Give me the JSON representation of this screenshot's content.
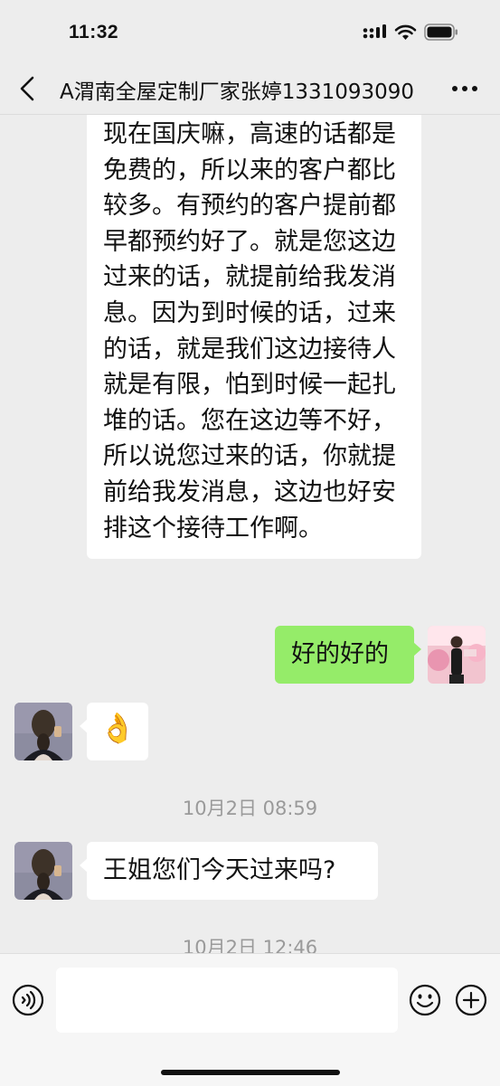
{
  "status_bar": {
    "time": "11:32"
  },
  "header": {
    "title": "A渭南全屋定制厂家张婷1331093090",
    "back_icon": "chevron-left-icon",
    "more_icon": "more-dots-icon"
  },
  "messages": [
    {
      "side": "in",
      "text": "现在国庆嘛，高速的话都是免费的，所以来的客户都比较多。有预约的客户提前都早都预约好了。就是您这边过来的话，就提前给我发消息。因为到时候的话，过来的话，就是我们这边接待人就是有限，怕到时候一起扎堆的话。您在这边等不好，所以说您过来的话，你就提前给我发消息，这边也好安排这个接待工作啊。"
    },
    {
      "side": "out",
      "text": "好的好的"
    },
    {
      "side": "in",
      "emoji": "👌"
    },
    {
      "timestamp": "10月2日 08:59"
    },
    {
      "side": "in",
      "text": "王姐您们今天过来吗?"
    },
    {
      "timestamp": "10月2日 12:46"
    }
  ],
  "input": {
    "value": "",
    "voice_icon": "voice-icon",
    "emoji_icon": "emoji-icon",
    "plus_icon": "plus-icon"
  },
  "colors": {
    "background": "#ededed",
    "incoming": "#ffffff",
    "outgoing": "#95ec69",
    "timestamp": "#9a9a9a"
  }
}
